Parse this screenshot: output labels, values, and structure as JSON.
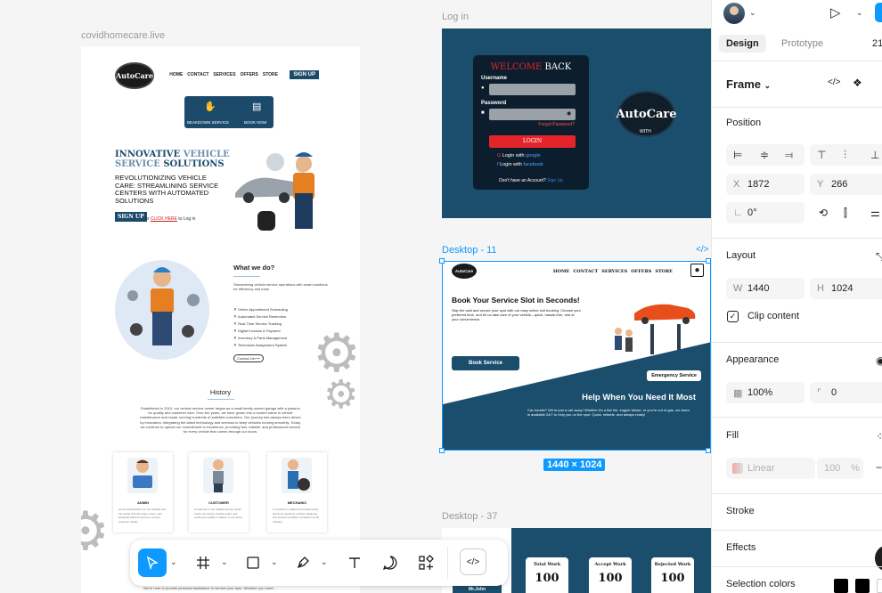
{
  "canvas": {
    "frames": {
      "left_label": "covidhomecare.live",
      "login_label": "Log in",
      "d11_label": "Desktop - 11",
      "d37_label": "Desktop - 37",
      "size_badge": "1440 × 1024"
    },
    "left": {
      "logo": "AutoCare",
      "nav_links": [
        "HOME",
        "CONTACT",
        "SERVICES",
        "OFFERS",
        "STORE"
      ],
      "nav_signup": "SIGN UP",
      "breakdown_label": "BEAKDOWN SERVICE",
      "book_label": "BOOK NOW",
      "hero_title_a": "INNOVATIVE",
      "hero_title_b": "VEHICLE",
      "hero_title_c": "SERVICE",
      "hero_title_d": "SOLUTIONS",
      "hero_sub": "REVOLUTIONIZING VEHICLE CARE: STREAMLINING SERVICE CENTERS WITH AUTOMATED SOLUTIONS",
      "hero_signup": "SIGN UP",
      "hero_login_pre": "or",
      "hero_login_link": "CLICK HERE",
      "hero_login_post": "to Log in",
      "wwd_title": "What we do?",
      "wwd_desc": "Streamlining vehicle service operations with smart solutions for efficiency and ease.",
      "features": [
        "Online Appointment Scheduling",
        "Automated Service Reminders",
        "Real-Time Service Tracking",
        "Digital Invoices & Payment",
        "Inventory & Parts Management",
        "Technician Assignment System"
      ],
      "contact_btn": "Contact Us⟶",
      "history_title": "History",
      "history_text": "Established in 2010, our vehicle service center began as a small family-owned garage with a passion for quality and customer care. Over the years, we have grown into a trusted name in vehicle maintenance and repair, serving hundreds of satisfied customers. Our journey has always been driven by innovation, integrating the latest technology and services to keep vehicles running smoothly. Today, we continue to uphold our commitment to excellence, providing fast, reliable, and professional service for every vehicle that comes through our doors.",
      "roles": [
        {
          "name": "ADMIN",
          "desc": "As an administrator, it's our visibility and the tender that the proper users, and accepted efficient service to ensure customer satisfy"
        },
        {
          "name": "CUSTOMER",
          "desc": "A customer is our reliable service center trusts our service, hassle-repair, and continuous quality to deliver to our doors"
        },
        {
          "name": "MECHANIC",
          "desc": "A mechanic is skilled and hands family functions repairing, problem diagnose, and ensures excellent completion of all vehicles"
        }
      ],
      "footer_text": "We're here to provide personal assistance to service your auto. Whether you need..."
    },
    "login": {
      "title_red": "WELCOME",
      "title_white": "BACK",
      "username_label": "Username",
      "password_label": "Password",
      "forgot": "Forgot Password?",
      "login_btn": "LOGIN",
      "google_pre": "Login with",
      "google_link": "google",
      "facebook_pre": "Login with",
      "facebook_link": "facebook",
      "no_account": "Don't have an Account?",
      "signup_link": "Sign Up",
      "logo": "AutoCare",
      "logo_sub": "WITH"
    },
    "d11": {
      "logo": "AutoCare",
      "nav_links": [
        "HOME",
        "CONTACT",
        "SERVICES",
        "OFFERS",
        "STORE"
      ],
      "title": "Book Your Service Slot in Seconds!",
      "desc": "Skip the wait and secure your spot with our easy online slot booking. Choose your preferred time, and let us take care of your vehicle—quick, hassle-free, and at your convenience.",
      "book_btn": "Book Service",
      "emergency_btn": "Emergency Service",
      "help_title": "Help When You Need It Most",
      "help_desc": "Car trouble? We're just a call away! Whether it's a flat tire, engine failure, or you're out of gas, our team is available 24/7 to help you on the spot. Quick, reliable, and always ready!"
    },
    "d37": {
      "user": "Mr.John",
      "stats": [
        {
          "title": "Total Work",
          "value": "100"
        },
        {
          "title": "Accept Work",
          "value": "100"
        },
        {
          "title": "Rejected Work",
          "value": "100"
        }
      ]
    }
  },
  "toolbar": {
    "tools": [
      "move-tool",
      "frame-tool",
      "shape-tool",
      "pen-tool",
      "text-tool",
      "comment-tool",
      "actions-tool",
      "dev-mode-toggle"
    ]
  },
  "panel": {
    "tabs": [
      "Design",
      "Prototype"
    ],
    "zoom": "21",
    "frame_label": "Frame",
    "position": {
      "title": "Position",
      "x_label": "X",
      "x": "1872",
      "y_label": "Y",
      "y": "266",
      "rotation": "0°"
    },
    "layout": {
      "title": "Layout",
      "w_label": "W",
      "w": "1440",
      "h_label": "H",
      "h": "1024",
      "clip_content": "Clip content"
    },
    "appearance": {
      "title": "Appearance",
      "opacity": "100%",
      "radius": "0"
    },
    "fill": {
      "title": "Fill",
      "type": "Linear",
      "opacity": "100",
      "unit": "%"
    },
    "stroke": "Stroke",
    "effects": "Effects",
    "selection_colors": "Selection colors",
    "colors": {
      "accent": "#0d99ff",
      "brand": "#1a4e6c",
      "danger": "#e3252b"
    }
  }
}
